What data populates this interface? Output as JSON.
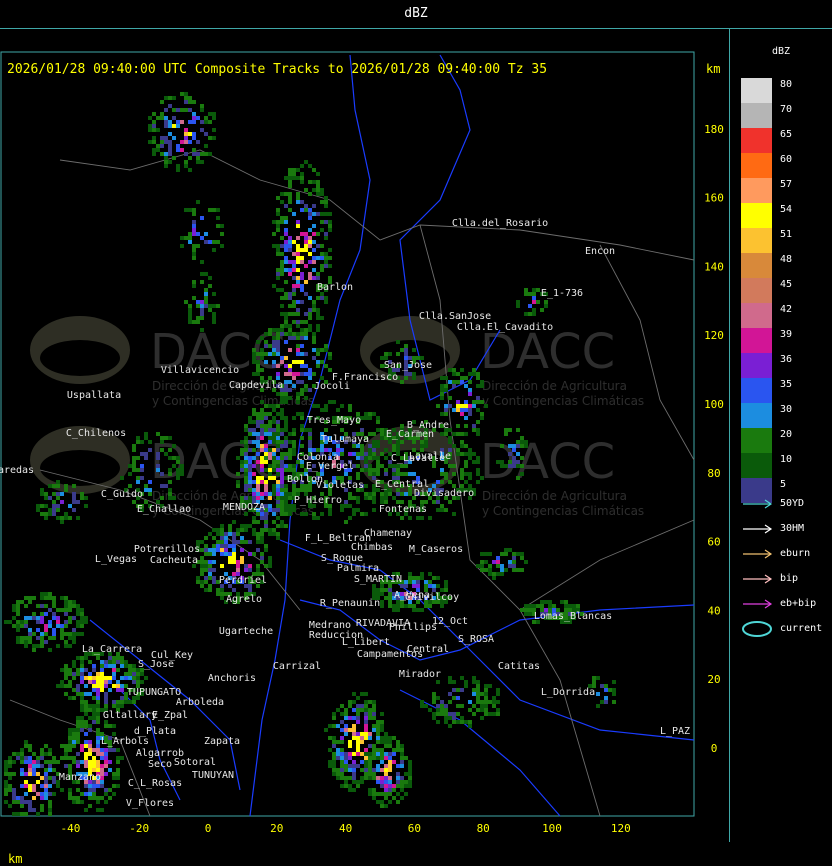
{
  "window": {
    "title": "dBZ"
  },
  "header": {
    "text": "2026/01/28 09:40:00 UTC Composite Tracks to 2026/01/28 09:40:00 Tz 35",
    "km_unit": "km"
  },
  "axes": {
    "unit": "km",
    "x_ticks": [
      "-40",
      "-20",
      "0",
      "20",
      "40",
      "60",
      "80",
      "100",
      "120"
    ],
    "y_ticks": [
      "180",
      "160",
      "140",
      "120",
      "100",
      "80",
      "60",
      "40",
      "20",
      "0"
    ]
  },
  "legend": {
    "title": "dBZ",
    "scale": [
      {
        "value": "80",
        "color": "#d9d9d9"
      },
      {
        "value": "70",
        "color": "#b5b5b5"
      },
      {
        "value": "65",
        "color": "#f0322c"
      },
      {
        "value": "60",
        "color": "#ff6a13"
      },
      {
        "value": "57",
        "color": "#ff9a5e"
      },
      {
        "value": "54",
        "color": "#ffff00"
      },
      {
        "value": "51",
        "color": "#fcc230"
      },
      {
        "value": "48",
        "color": "#d8893a"
      },
      {
        "value": "45",
        "color": "#d27a5c"
      },
      {
        "value": "42",
        "color": "#d06a8c"
      },
      {
        "value": "39",
        "color": "#d21596"
      },
      {
        "value": "36",
        "color": "#7a1fd4"
      },
      {
        "value": "35",
        "color": "#2a55f0"
      },
      {
        "value": "30",
        "color": "#1c8de0"
      },
      {
        "value": "20",
        "color": "#1a7a0e"
      },
      {
        "value": "10",
        "color": "#0a5a0a"
      },
      {
        "value": "5",
        "color": "#3a3a8a"
      }
    ],
    "tracks": [
      {
        "label": "50YD",
        "color": "#4fd6d6"
      },
      {
        "label": "30HM",
        "color": "#ffffff"
      },
      {
        "label": "eburn",
        "color": "#f0c070"
      },
      {
        "label": "bip",
        "color": "#ffc0c0"
      },
      {
        "label": "eb+bip",
        "color": "#e040e0"
      },
      {
        "label": "current",
        "color": "#4fd6d6"
      }
    ]
  },
  "watermark": {
    "brand": "DACC",
    "subtitle_1": "Dirección de Agricultura",
    "subtitle_2": "y Contingencias Climáticas"
  },
  "places": [
    {
      "name": "Clla.del_Rosario",
      "x": 500,
      "y": 226
    },
    {
      "name": "Encon",
      "x": 600,
      "y": 254
    },
    {
      "name": "E_1-736",
      "x": 562,
      "y": 296
    },
    {
      "name": "Clla.SanJose",
      "x": 455,
      "y": 319
    },
    {
      "name": "Clla.El_Cavadito",
      "x": 505,
      "y": 330
    },
    {
      "name": "Jocoli",
      "x": 332,
      "y": 389
    },
    {
      "name": "Barlon",
      "x": 335,
      "y": 290
    },
    {
      "name": "F.Francisco",
      "x": 365,
      "y": 380
    },
    {
      "name": "San_Jose",
      "x": 408,
      "y": 368
    },
    {
      "name": "Villavicencio",
      "x": 200,
      "y": 373
    },
    {
      "name": "Capdevila",
      "x": 256,
      "y": 388
    },
    {
      "name": "Uspallata",
      "x": 94,
      "y": 398
    },
    {
      "name": "C_Chilenos",
      "x": 96,
      "y": 436
    },
    {
      "name": "Tres_Mayo",
      "x": 334,
      "y": 423
    },
    {
      "name": "Tulumaya",
      "x": 345,
      "y": 442
    },
    {
      "name": "E_Carmen",
      "x": 410,
      "y": 437
    },
    {
      "name": "B_Andre",
      "x": 428,
      "y": 428
    },
    {
      "name": "C_Lavalle",
      "x": 418,
      "y": 461
    },
    {
      "name": "E_Vergel",
      "x": 330,
      "y": 469
    },
    {
      "name": "Colonia",
      "x": 318,
      "y": 460
    },
    {
      "name": "E_Central",
      "x": 402,
      "y": 487
    },
    {
      "name": "Lavalle",
      "x": 430,
      "y": 459
    },
    {
      "name": "Divisadero",
      "x": 444,
      "y": 496
    },
    {
      "name": "Violetas",
      "x": 340,
      "y": 488
    },
    {
      "name": "P_Hierro",
      "x": 318,
      "y": 503
    },
    {
      "name": "Bollon",
      "x": 305,
      "y": 482
    },
    {
      "name": "C_Guido",
      "x": 122,
      "y": 497
    },
    {
      "name": "E_Challao",
      "x": 164,
      "y": 512
    },
    {
      "name": "MENDOZA",
      "x": 244,
      "y": 510
    },
    {
      "name": "Fontenas",
      "x": 403,
      "y": 512
    },
    {
      "name": "Chamenay",
      "x": 388,
      "y": 536
    },
    {
      "name": "F_L_Beltran",
      "x": 338,
      "y": 541
    },
    {
      "name": "Chimbas",
      "x": 372,
      "y": 550
    },
    {
      "name": "M_Caseros",
      "x": 436,
      "y": 552
    },
    {
      "name": "Potrerillos",
      "x": 167,
      "y": 552
    },
    {
      "name": "Cacheuta",
      "x": 174,
      "y": 563
    },
    {
      "name": "L_Vegas",
      "x": 116,
      "y": 562
    },
    {
      "name": "S_Roque",
      "x": 342,
      "y": 561
    },
    {
      "name": "Palmira",
      "x": 358,
      "y": 571
    },
    {
      "name": "S_MARTIN",
      "x": 378,
      "y": 582
    },
    {
      "name": "Perdriel",
      "x": 243,
      "y": 583
    },
    {
      "name": "A_Vena",
      "x": 412,
      "y": 598
    },
    {
      "name": "Agrelo",
      "x": 244,
      "y": 602
    },
    {
      "name": "R_Penaunin",
      "x": 350,
      "y": 606
    },
    {
      "name": "Chivilcoy",
      "x": 432,
      "y": 600
    },
    {
      "name": "Ugarteche",
      "x": 246,
      "y": 634
    },
    {
      "name": "Medrano",
      "x": 330,
      "y": 628
    },
    {
      "name": "RIVADAVIA",
      "x": 383,
      "y": 626
    },
    {
      "name": "Reduccion",
      "x": 336,
      "y": 638
    },
    {
      "name": "Phillips",
      "x": 413,
      "y": 630
    },
    {
      "name": "12_Oct",
      "x": 450,
      "y": 624
    },
    {
      "name": "Lomas_Blancas",
      "x": 573,
      "y": 619
    },
    {
      "name": "S_ROSA",
      "x": 476,
      "y": 642
    },
    {
      "name": "L_Libert",
      "x": 366,
      "y": 645
    },
    {
      "name": "Central",
      "x": 428,
      "y": 652
    },
    {
      "name": "Campamentos",
      "x": 390,
      "y": 657
    },
    {
      "name": "La_Carrera",
      "x": 112,
      "y": 652
    },
    {
      "name": "Cul_Key",
      "x": 172,
      "y": 658
    },
    {
      "name": "S_Jose",
      "x": 156,
      "y": 667
    },
    {
      "name": "Carrizal",
      "x": 297,
      "y": 669
    },
    {
      "name": "Catitas",
      "x": 519,
      "y": 669
    },
    {
      "name": "Anchoris",
      "x": 232,
      "y": 681
    },
    {
      "name": "Mirador",
      "x": 420,
      "y": 677
    },
    {
      "name": "TUPUNGATO",
      "x": 154,
      "y": 695
    },
    {
      "name": "L_Dorrida",
      "x": 568,
      "y": 695
    },
    {
      "name": "Arboleda",
      "x": 200,
      "y": 705
    },
    {
      "name": "Gltallary",
      "x": 130,
      "y": 718
    },
    {
      "name": "E_Zpal",
      "x": 170,
      "y": 718
    },
    {
      "name": "d_Plata",
      "x": 155,
      "y": 734
    },
    {
      "name": "L_Arbols",
      "x": 125,
      "y": 744
    },
    {
      "name": "Zapata",
      "x": 222,
      "y": 744
    },
    {
      "name": "L_PAZ",
      "x": 675,
      "y": 734
    },
    {
      "name": "Algarrob",
      "x": 160,
      "y": 756
    },
    {
      "name": "Seco",
      "x": 160,
      "y": 767
    },
    {
      "name": "Sotoral",
      "x": 195,
      "y": 765
    },
    {
      "name": "TUNUYAN",
      "x": 213,
      "y": 778
    },
    {
      "name": "C_L_Rosas",
      "x": 155,
      "y": 786
    },
    {
      "name": "Manzano",
      "x": 80,
      "y": 780
    },
    {
      "name": "V_Flores",
      "x": 150,
      "y": 806
    },
    {
      "name": "aredas",
      "x": 16,
      "y": 473
    }
  ]
}
